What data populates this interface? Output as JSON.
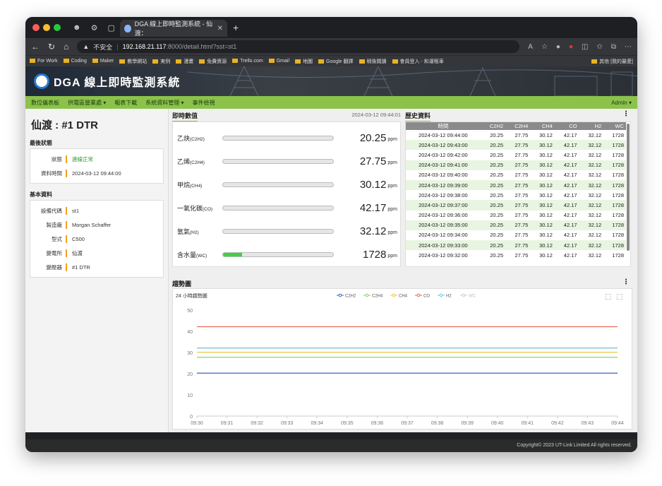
{
  "browser": {
    "tab_title": "DGA 線上即時監測系統 - 仙渡：",
    "new_tab": "+",
    "security": "不安全",
    "url_host": "192.168.21.117",
    "url_path": ":8000/detail.html?sst=st1",
    "bookmarks": [
      "For Work",
      "Coding",
      "Maker",
      "教學網站",
      "実例",
      "漫畫",
      "免費資源",
      "Trello.com",
      "Gmail",
      "地圖",
      "Google 翻譯",
      "稍後閱讀",
      "會員登入 - 和運租車",
      "其他 [我的最愛]"
    ]
  },
  "app": {
    "title": "DGA 線上即時監測系統",
    "nav": [
      "數位儀表板",
      "供電區營業處 ▾",
      "報表下載",
      "系統資料管理 ▾",
      "事件檢視"
    ],
    "user": "Admin ▾",
    "footer": "Copyright© 2023 UT-Link Limited All rights reserved."
  },
  "station": {
    "name": "仙渡 : #1 DTR",
    "last_status_title": "最後狀態",
    "status_label": "狀態",
    "status_value": "連線正常",
    "time_label": "資料時間",
    "time_value": "2024-03-12 09:44:00",
    "basic_title": "基本資料",
    "basic": [
      {
        "k": "設備代碼",
        "v": "st1"
      },
      {
        "k": "製造廠",
        "v": "Morgan Schaffer"
      },
      {
        "k": "型式",
        "v": "C500"
      },
      {
        "k": "變電所",
        "v": "仙渡"
      },
      {
        "k": "變壓器",
        "v": "#1 DTR"
      }
    ]
  },
  "realtime": {
    "title": "即時數值",
    "timestamp": "2024-03-12 09:44:01",
    "items": [
      {
        "name": "乙炔",
        "code": "(C2H2)",
        "value": "20.25",
        "unit": "ppm",
        "level": 0
      },
      {
        "name": "乙烯",
        "code": "(C2H4)",
        "value": "27.75",
        "unit": "ppm",
        "level": 0
      },
      {
        "name": "甲烷",
        "code": "(CH4)",
        "value": "30.12",
        "unit": "ppm",
        "level": 0
      },
      {
        "name": "一氧化碳",
        "code": "(CO)",
        "value": "42.17",
        "unit": "ppm",
        "level": 0
      },
      {
        "name": "氫氣",
        "code": "(H2)",
        "value": "32.12",
        "unit": "ppm",
        "level": 0
      },
      {
        "name": "含水量",
        "code": "(WC)",
        "value": "1728",
        "unit": "ppm",
        "level": 0.17
      }
    ]
  },
  "history": {
    "title": "歷史資料",
    "columns": [
      "時間",
      "C2H2",
      "C2H4",
      "CH4",
      "CO",
      "H2",
      "WC"
    ],
    "rows": [
      [
        "2024-03-12 09:44:00",
        "20.25",
        "27.75",
        "30.12",
        "42.17",
        "32.12",
        "1728"
      ],
      [
        "2024-03-12 09:43:00",
        "20.25",
        "27.75",
        "30.12",
        "42.17",
        "32.12",
        "1728"
      ],
      [
        "2024-03-12 09:42:00",
        "20.25",
        "27.75",
        "30.12",
        "42.17",
        "32.12",
        "1728"
      ],
      [
        "2024-03-12 09:41:00",
        "20.25",
        "27.75",
        "30.12",
        "42.17",
        "32.12",
        "1728"
      ],
      [
        "2024-03-12 09:40:00",
        "20.25",
        "27.75",
        "30.12",
        "42.17",
        "32.12",
        "1728"
      ],
      [
        "2024-03-12 09:39:00",
        "20.25",
        "27.75",
        "30.12",
        "42.17",
        "32.12",
        "1728"
      ],
      [
        "2024-03-12 09:38:00",
        "20.25",
        "27.75",
        "30.12",
        "42.17",
        "32.12",
        "1728"
      ],
      [
        "2024-03-12 09:37:00",
        "20.25",
        "27.75",
        "30.12",
        "42.17",
        "32.12",
        "1728"
      ],
      [
        "2024-03-12 09:36:00",
        "20.25",
        "27.75",
        "30.12",
        "42.17",
        "32.12",
        "1728"
      ],
      [
        "2024-03-12 09:35:00",
        "20.25",
        "27.75",
        "30.12",
        "42.17",
        "32.12",
        "1728"
      ],
      [
        "2024-03-12 09:34:00",
        "20.25",
        "27.75",
        "30.12",
        "42.17",
        "32.12",
        "1728"
      ],
      [
        "2024-03-12 09:33:00",
        "20.25",
        "27.75",
        "30.12",
        "42.17",
        "32.12",
        "1728"
      ],
      [
        "2024-03-12 09:32:00",
        "20.25",
        "27.75",
        "30.12",
        "42.17",
        "32.12",
        "1728"
      ]
    ]
  },
  "chart_data": {
    "type": "line",
    "panel_title": "趨勢圖",
    "title": "24 小時趨勢圖",
    "x": [
      "09:30",
      "09:31",
      "09:32",
      "09:33",
      "09:34",
      "09:35",
      "09:36",
      "09:37",
      "09:38",
      "09:39",
      "09:40",
      "09:41",
      "09:42",
      "09:43",
      "09:44"
    ],
    "ylim": [
      0,
      50
    ],
    "yticks": [
      0,
      10,
      20,
      30,
      40,
      50
    ],
    "series": [
      {
        "name": "C2H2",
        "color": "#3b5fc2",
        "values": [
          20.25,
          20.25,
          20.25,
          20.25,
          20.25,
          20.25,
          20.25,
          20.25,
          20.25,
          20.25,
          20.25,
          20.25,
          20.25,
          20.25,
          20.25
        ]
      },
      {
        "name": "C2H4",
        "color": "#8bcf6b",
        "values": [
          27.75,
          27.75,
          27.75,
          27.75,
          27.75,
          27.75,
          27.75,
          27.75,
          27.75,
          27.75,
          27.75,
          27.75,
          27.75,
          27.75,
          27.75
        ]
      },
      {
        "name": "CH4",
        "color": "#f5c242",
        "values": [
          30.12,
          30.12,
          30.12,
          30.12,
          30.12,
          30.12,
          30.12,
          30.12,
          30.12,
          30.12,
          30.12,
          30.12,
          30.12,
          30.12,
          30.12
        ]
      },
      {
        "name": "CO",
        "color": "#e8665a",
        "values": [
          42.17,
          42.17,
          42.17,
          42.17,
          42.17,
          42.17,
          42.17,
          42.17,
          42.17,
          42.17,
          42.17,
          42.17,
          42.17,
          42.17,
          42.17
        ]
      },
      {
        "name": "H2",
        "color": "#6cc1e8",
        "values": [
          32.12,
          32.12,
          32.12,
          32.12,
          32.12,
          32.12,
          32.12,
          32.12,
          32.12,
          32.12,
          32.12,
          32.12,
          32.12,
          32.12,
          32.12
        ]
      },
      {
        "name": "WC",
        "color": "#cccccc",
        "values": [
          1728,
          1728,
          1728,
          1728,
          1728,
          1728,
          1728,
          1728,
          1728,
          1728,
          1728,
          1728,
          1728,
          1728,
          1728
        ],
        "hidden": true
      }
    ],
    "legend": "top"
  }
}
